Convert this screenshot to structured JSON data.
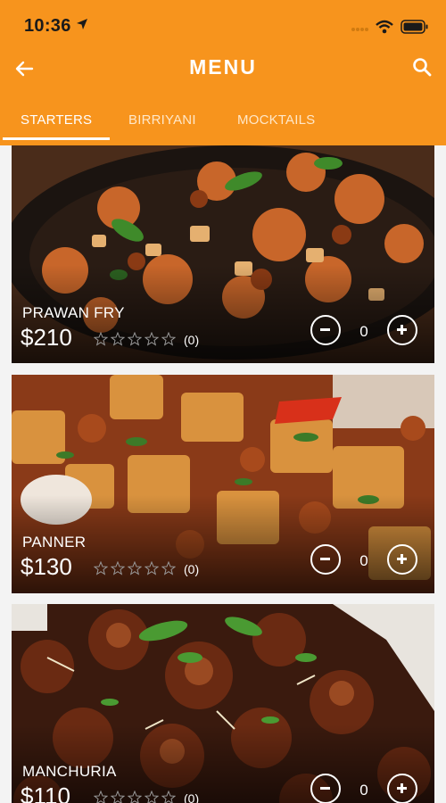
{
  "status_bar": {
    "time": "10:36"
  },
  "header": {
    "title": "MENU"
  },
  "tabs": [
    {
      "label": "STARTERS",
      "active": true
    },
    {
      "label": "BIRRIYANI",
      "active": false
    },
    {
      "label": "MOCKTAILS",
      "active": false
    }
  ],
  "items": [
    {
      "name": "PRAWAN FRY",
      "price": "$210",
      "rating": 0,
      "rating_count": "(0)",
      "quantity": "0"
    },
    {
      "name": "PANNER",
      "price": "$130",
      "rating": 0,
      "rating_count": "(0)",
      "quantity": "0"
    },
    {
      "name": "MANCHURIA",
      "price": "$110",
      "rating": 0,
      "rating_count": "(0)",
      "quantity": "0"
    }
  ],
  "colors": {
    "header": "#f7941d",
    "active_tab": "#ffffff",
    "inactive_tab": "#ffe7c8"
  },
  "icons": [
    "location-arrow-icon",
    "wifi-icon",
    "battery-icon",
    "back-arrow-icon",
    "search-icon",
    "star-outline-icon",
    "minus-circle-icon",
    "plus-circle-icon"
  ]
}
